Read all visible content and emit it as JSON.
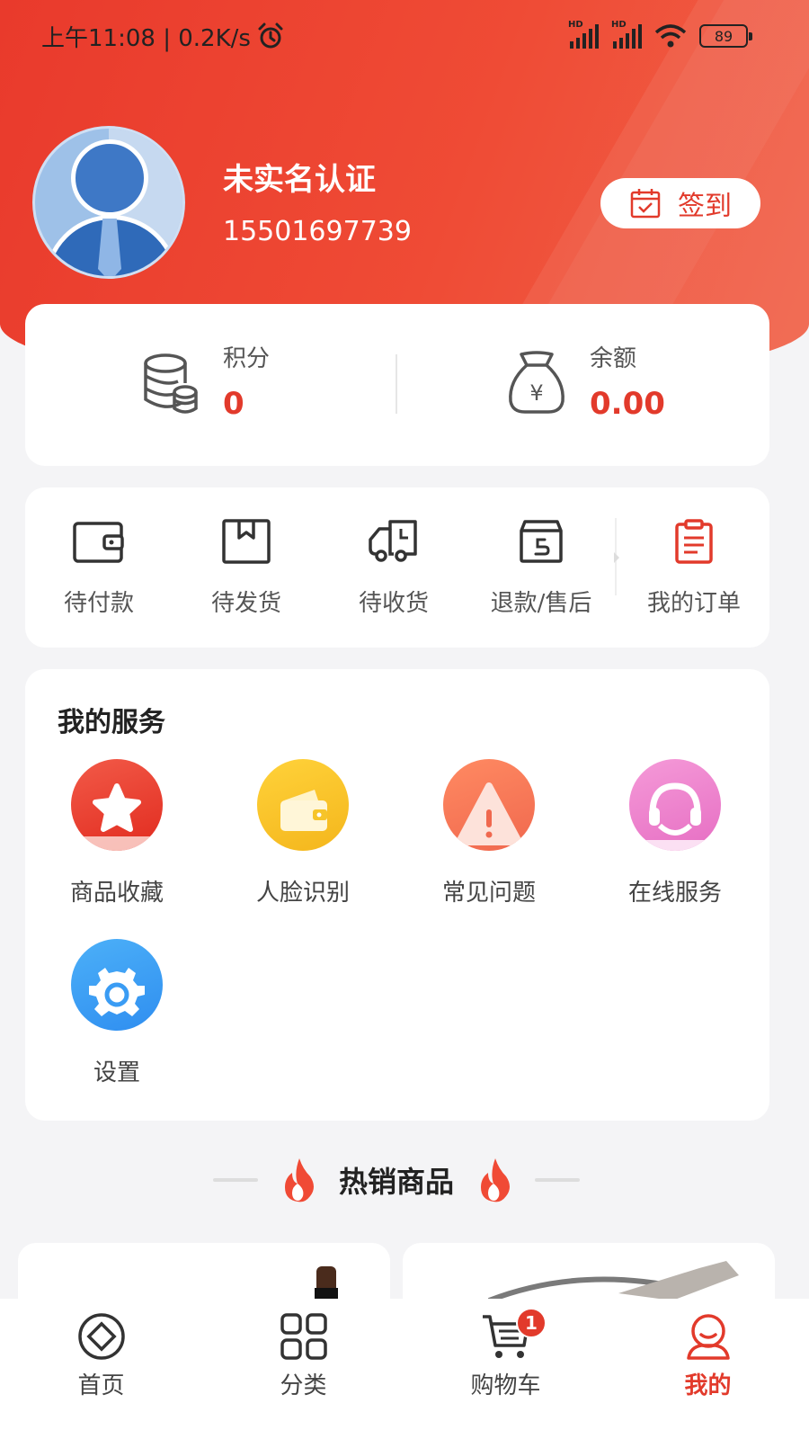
{
  "status_bar": {
    "time_speed": "上午11:08 | 0.2K/s",
    "battery": "89",
    "network_label": "HD"
  },
  "profile": {
    "name": "未实名认证",
    "phone": "15501697739",
    "checkin_label": "签到"
  },
  "assets": {
    "points_label": "积分",
    "points_value": "0",
    "balance_label": "余额",
    "balance_value": "0.00"
  },
  "orders": {
    "items": [
      {
        "label": "待付款",
        "icon": "wallet-icon"
      },
      {
        "label": "待发货",
        "icon": "box-icon"
      },
      {
        "label": "待收货",
        "icon": "truck-icon"
      },
      {
        "label": "退款/售后",
        "icon": "return-icon"
      }
    ],
    "all_orders_label": "我的订单"
  },
  "services": {
    "title": "我的服务",
    "items": [
      {
        "label": "商品收藏",
        "icon": "star-icon"
      },
      {
        "label": "人脸识别",
        "icon": "card-wallet-icon"
      },
      {
        "label": "常见问题",
        "icon": "warning-icon"
      },
      {
        "label": "在线服务",
        "icon": "headset-icon"
      },
      {
        "label": "设置",
        "icon": "gear-icon"
      }
    ]
  },
  "hot_products": {
    "title": "热销商品"
  },
  "tabbar": {
    "items": [
      {
        "label": "首页",
        "icon": "home-icon"
      },
      {
        "label": "分类",
        "icon": "category-icon"
      },
      {
        "label": "购物车",
        "icon": "cart-icon"
      },
      {
        "label": "我的",
        "icon": "profile-icon"
      }
    ],
    "cart_badge": "1",
    "active_index": 3
  },
  "colors": {
    "brand_red": "#e23a2b",
    "header_gradient_start": "#e93a2c",
    "header_gradient_end": "#f0634a"
  }
}
